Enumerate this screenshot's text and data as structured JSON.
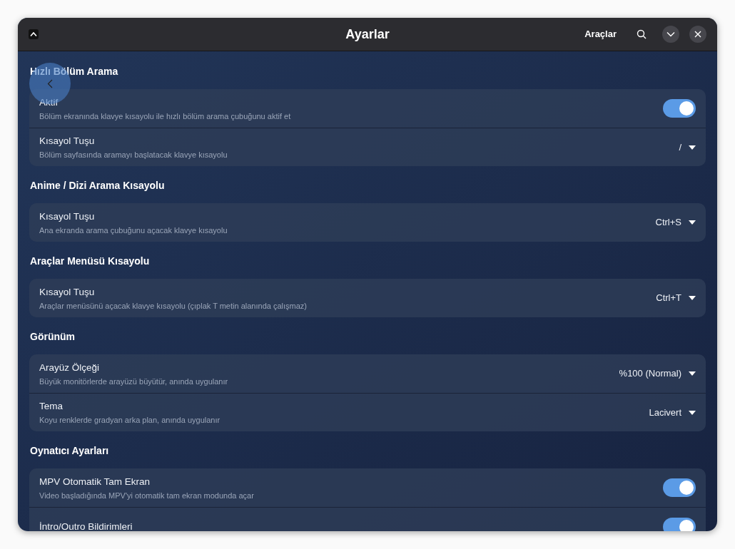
{
  "window": {
    "title": "Ayarlar"
  },
  "header": {
    "menu_label": "Araçlar"
  },
  "sections": [
    {
      "title": "Hızlı Bölüm Arama",
      "rows": [
        {
          "kind": "toggle",
          "label": "Aktif",
          "description": "Bölüm ekranında klavye kısayolu ile hızlı bölüm arama çubuğunu aktif et",
          "on": true
        },
        {
          "kind": "dropdown",
          "label": "Kısayol Tuşu",
          "description": "Bölüm sayfasında aramayı başlatacak klavye kısayolu",
          "value": "/"
        }
      ]
    },
    {
      "title": "Anime / Dizi Arama Kısayolu",
      "rows": [
        {
          "kind": "dropdown",
          "label": "Kısayol Tuşu",
          "description": "Ana ekranda arama çubuğunu açacak klavye kısayolu",
          "value": "Ctrl+S"
        }
      ]
    },
    {
      "title": "Araçlar Menüsü Kısayolu",
      "rows": [
        {
          "kind": "dropdown",
          "label": "Kısayol Tuşu",
          "description": "Araçlar menüsünü açacak klavye kısayolu (çıplak T metin alanında çalışmaz)",
          "value": "Ctrl+T"
        }
      ]
    },
    {
      "title": "Görünüm",
      "rows": [
        {
          "kind": "dropdown",
          "label": "Arayüz Ölçeği",
          "description": "Büyük monitörlerde arayüzü büyütür, anında uygulanır",
          "value": "%100 (Normal)"
        },
        {
          "kind": "dropdown",
          "label": "Tema",
          "description": "Koyu renklerde gradyan arka plan, anında uygulanır",
          "value": "Lacivert"
        }
      ]
    },
    {
      "title": "Oynatıcı Ayarları",
      "rows": [
        {
          "kind": "toggle",
          "label": "MPV Otomatik Tam Ekran",
          "description": "Video başladığında MPV'yi otomatik tam ekran modunda açar",
          "on": true
        },
        {
          "kind": "toggle",
          "label": "İntro/Outro Bildirimleri",
          "on": true
        }
      ]
    }
  ]
}
